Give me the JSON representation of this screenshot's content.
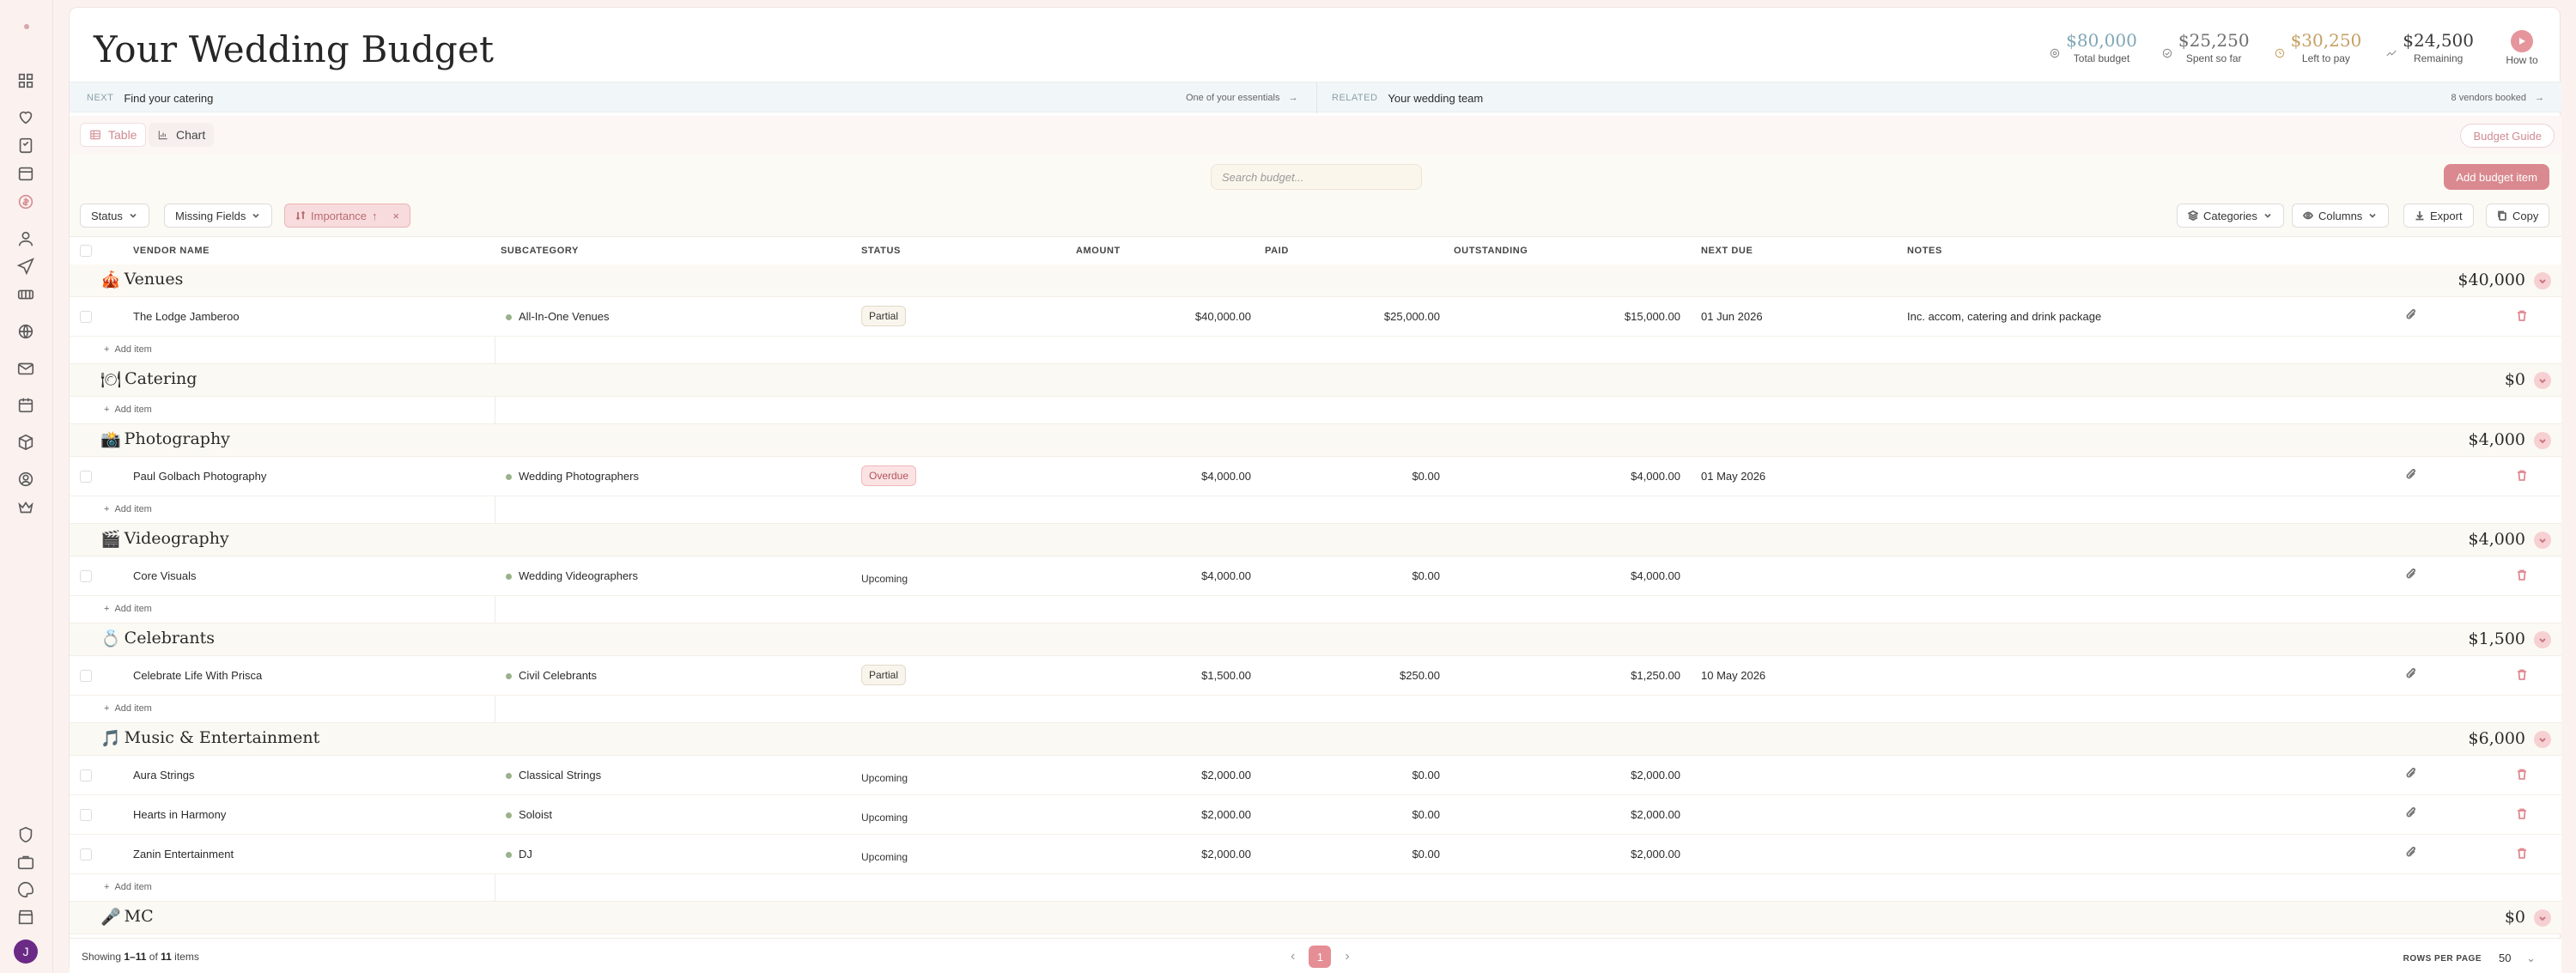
{
  "app": {
    "title": "Your Wedding Budget",
    "user_initial": "J",
    "accent_color": "#d9898f"
  },
  "stats": [
    {
      "value": "$80,000",
      "label": "Total budget",
      "color": "#7fa7b5",
      "icon": "target-icon"
    },
    {
      "value": "$25,250",
      "label": "Spent so far",
      "color": "#6f6f6f",
      "icon": "check-circle-icon"
    },
    {
      "value": "$30,250",
      "label": "Left to pay",
      "color": "#c5a064",
      "icon": "clock-icon"
    },
    {
      "value": "$24,500",
      "label": "Remaining",
      "color": "#3a3a3a",
      "icon": "trend-icon"
    }
  ],
  "howto": {
    "label": "How to"
  },
  "next_bar": {
    "next_tag": "NEXT",
    "next_text": "Find your catering",
    "next_hint": "One of your essentials",
    "related_tag": "RELATED",
    "related_text": "Your wedding team",
    "related_hint": "8 vendors booked"
  },
  "view_tabs": {
    "table": "Table",
    "chart": "Chart",
    "guide": "Budget Guide"
  },
  "search": {
    "placeholder": "Search budget..."
  },
  "add_button": "Add budget item",
  "filters": {
    "status": "Status",
    "missing_fields": "Missing Fields",
    "importance": "Importance",
    "importance_arrow": "↑",
    "categories": "Categories",
    "columns": "Columns",
    "export": "Export",
    "copy": "Copy"
  },
  "columns": {
    "vendor": "VENDOR NAME",
    "subcategory": "SUBCATEGORY",
    "status": "STATUS",
    "amount": "AMOUNT",
    "paid": "PAID",
    "outstanding": "OUTSTANDING",
    "next_due": "NEXT DUE",
    "notes": "NOTES"
  },
  "add_item_label": "Add item",
  "categories": [
    {
      "emoji": "🎪",
      "name": "Venues",
      "total": "$40,000",
      "items": [
        {
          "vendor": "The Lodge Jamberoo",
          "subcategory": "All-In-One Venues",
          "status": "Partial",
          "amount": "$40,000.00",
          "paid": "$25,000.00",
          "outstanding": "$15,000.00",
          "next_due": "01 Jun 2026",
          "notes": "Inc. accom, catering and drink package"
        }
      ]
    },
    {
      "emoji": "🍽",
      "name": "Catering",
      "total": "$0",
      "items": []
    },
    {
      "emoji": "📸",
      "name": "Photography",
      "total": "$4,000",
      "items": [
        {
          "vendor": "Paul Golbach Photography",
          "subcategory": "Wedding Photographers",
          "status": "Overdue",
          "amount": "$4,000.00",
          "paid": "$0.00",
          "outstanding": "$4,000.00",
          "next_due": "01 May 2026",
          "notes": ""
        }
      ]
    },
    {
      "emoji": "🎬",
      "name": "Videography",
      "total": "$4,000",
      "items": [
        {
          "vendor": "Core Visuals",
          "subcategory": "Wedding Videographers",
          "status": "Upcoming",
          "amount": "$4,000.00",
          "paid": "$0.00",
          "outstanding": "$4,000.00",
          "next_due": "",
          "notes": ""
        }
      ]
    },
    {
      "emoji": "💍",
      "name": "Celebrants",
      "total": "$1,500",
      "items": [
        {
          "vendor": "Celebrate Life With Prisca",
          "subcategory": "Civil Celebrants",
          "status": "Partial",
          "amount": "$1,500.00",
          "paid": "$250.00",
          "outstanding": "$1,250.00",
          "next_due": "10 May 2026",
          "notes": ""
        }
      ]
    },
    {
      "emoji": "🎵",
      "name": "Music & Entertainment",
      "total": "$6,000",
      "items": [
        {
          "vendor": "Aura Strings",
          "subcategory": "Classical Strings",
          "status": "Upcoming",
          "amount": "$2,000.00",
          "paid": "$0.00",
          "outstanding": "$2,000.00",
          "next_due": "",
          "notes": ""
        },
        {
          "vendor": "Hearts in Harmony",
          "subcategory": "Soloist",
          "status": "Upcoming",
          "amount": "$2,000.00",
          "paid": "$0.00",
          "outstanding": "$2,000.00",
          "next_due": "",
          "notes": ""
        },
        {
          "vendor": "Zanin Entertainment",
          "subcategory": "DJ",
          "status": "Upcoming",
          "amount": "$2,000.00",
          "paid": "$0.00",
          "outstanding": "$2,000.00",
          "next_due": "",
          "notes": ""
        }
      ]
    },
    {
      "emoji": "🎤",
      "name": "MC",
      "total": "$0",
      "items": []
    }
  ],
  "footer": {
    "showing_prefix": "Showing",
    "showing_range": "1–11",
    "showing_of": "of",
    "showing_total": "11",
    "showing_suffix": "items",
    "page": "1",
    "rows_per_page_label": "ROWS PER PAGE",
    "rows_per_page": "50"
  }
}
